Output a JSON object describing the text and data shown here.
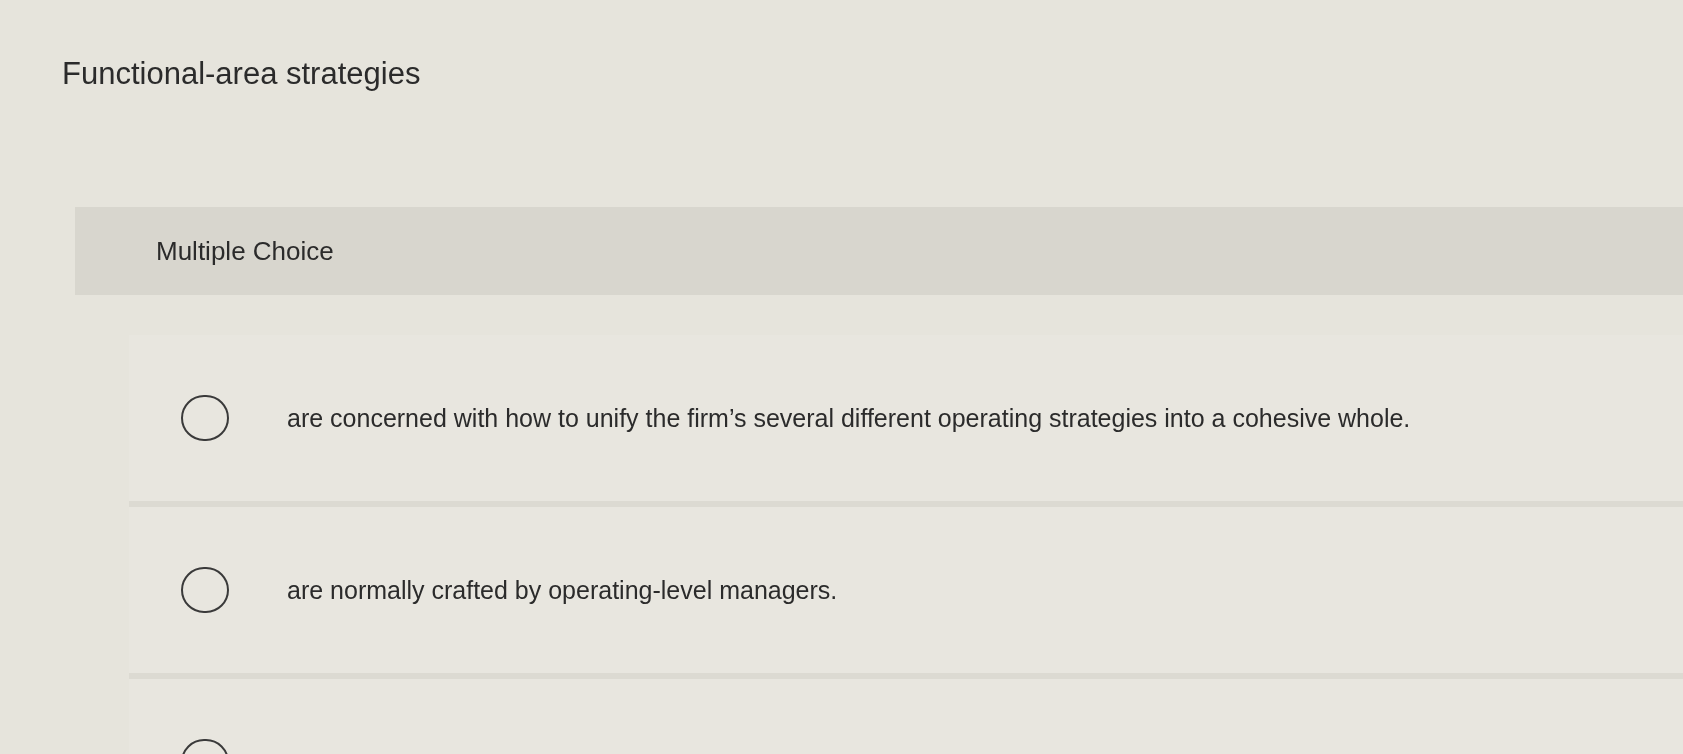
{
  "question": {
    "title": "Functional-area strategies"
  },
  "panel": {
    "label": "Multiple Choice"
  },
  "options": [
    {
      "label": "are concerned with how to unify the firm’s several different operating strategies into a cohesive whole.",
      "selected": false
    },
    {
      "label": "are normally crafted by operating-level managers.",
      "selected": false
    },
    {
      "selected": false
    }
  ]
}
